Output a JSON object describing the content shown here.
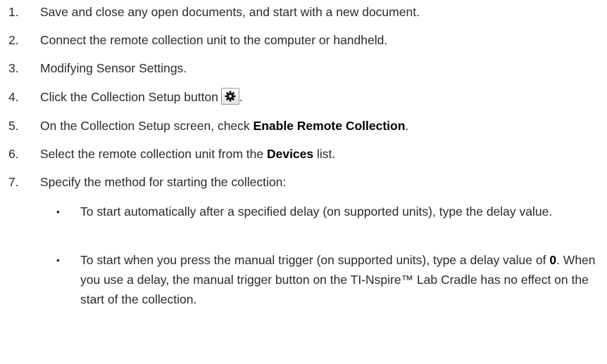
{
  "steps": [
    {
      "num": "1.",
      "text": "Save and close any open documents, and start with a new document."
    },
    {
      "num": "2.",
      "text": "Connect the remote collection unit to the computer or handheld."
    },
    {
      "num": "3.",
      "text": "Modifying Sensor Settings."
    },
    {
      "num": "4.",
      "pre": "Click the Collection Setup button",
      "post": ".",
      "icon": "gear-icon"
    },
    {
      "num": "5.",
      "pre": "On the Collection Setup screen, check ",
      "bold": "Enable Remote Collection",
      "post": "."
    },
    {
      "num": "6.",
      "pre": "Select the remote collection unit from the ",
      "bold": "Devices",
      "post": " list."
    },
    {
      "num": "7.",
      "text": "Specify the method for starting the collection:"
    }
  ],
  "bullets": [
    {
      "marker": "•",
      "text": "To start automatically after a specified delay (on supported units), type the delay value."
    },
    {
      "marker": "•",
      "pre": "To start when you press the manual trigger (on supported units), type a delay value of ",
      "bold": "0",
      "post": ". When you use a delay, the manual trigger button on the TI-Nspire™ Lab Cradle has no effect on the start of the collection."
    }
  ]
}
